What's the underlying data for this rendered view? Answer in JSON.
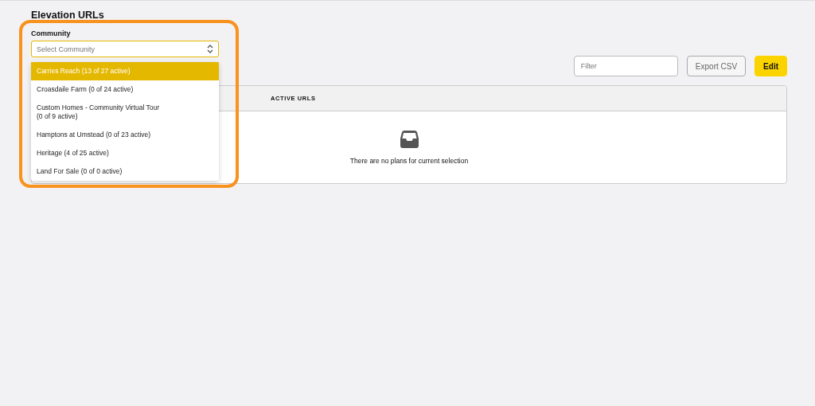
{
  "page": {
    "title": "Elevation URLs"
  },
  "community": {
    "label": "Community",
    "placeholder": "Select Community",
    "expanded": true,
    "options": [
      {
        "label": "Carries Reach (13 of 27 active)",
        "selected": true
      },
      {
        "label": "Croasdaile Farm (0 of 24 active)",
        "selected": false
      },
      {
        "label": "Custom Homes - Community Virtual Tour\n(0 of 9 active)",
        "selected": false
      },
      {
        "label": "Hamptons at Umstead (0 of 23 active)",
        "selected": false
      },
      {
        "label": "Heritage (4 of 25 active)",
        "selected": false
      },
      {
        "label": "Land For Sale (0 of 0 active)",
        "selected": false
      }
    ]
  },
  "toolbar": {
    "filter": {
      "placeholder": "Filter"
    },
    "buttons": [
      {
        "label": "Export CSV",
        "kind": "secondary"
      },
      {
        "label": "Edit",
        "kind": "primary"
      }
    ]
  },
  "table": {
    "columns": [
      "ACTIVE URLS"
    ],
    "empty_message": "There are no plans for current selection"
  }
}
